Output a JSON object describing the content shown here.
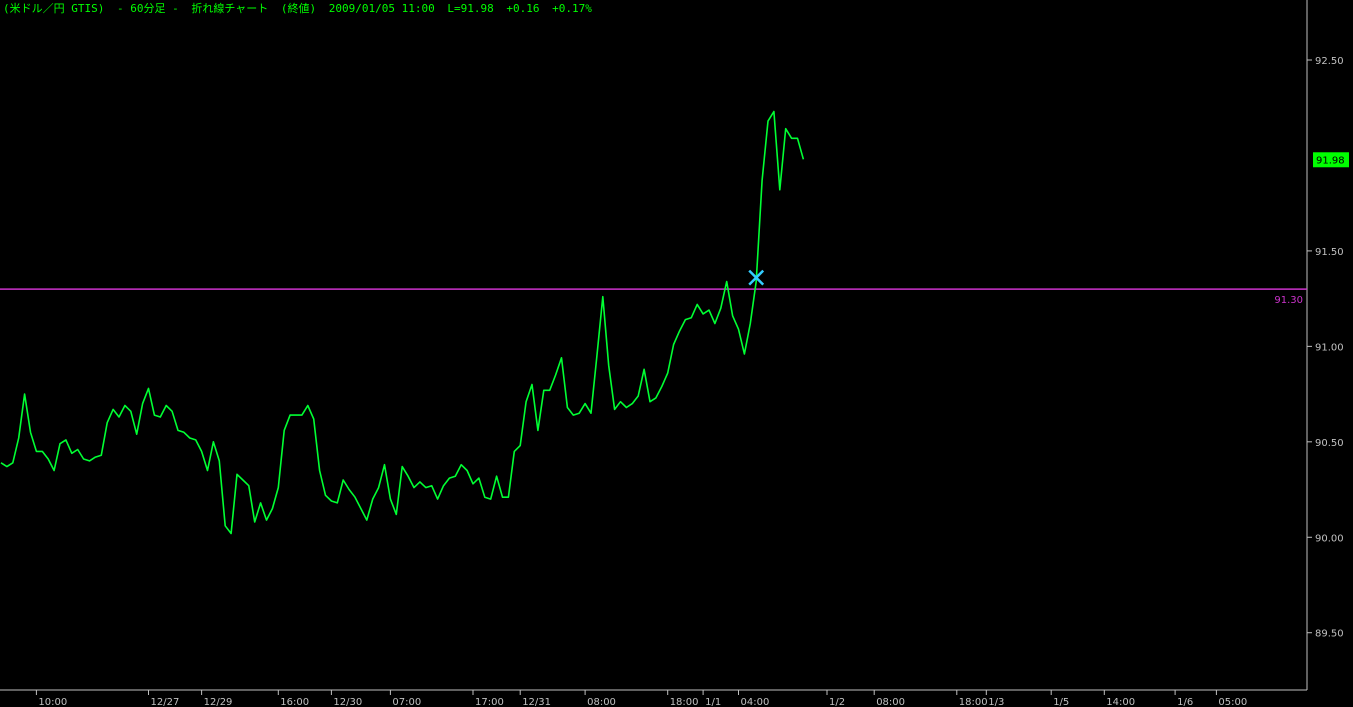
{
  "header": {
    "instrument": "(米ドル／円 GTIS)",
    "timeframe": "- 60分足 -",
    "chart_kind": "折れ線チャート",
    "price_type": "(終値)",
    "datetime": "2009/01/05 11:00",
    "last": "L=91.98",
    "change": "+0.16",
    "change_pct": "+0.17%"
  },
  "colors": {
    "background": "#000000",
    "line": "#00ff33",
    "axis": "#c0c0c0",
    "tick_text": "#c0c0c0",
    "hline": "#cc33cc",
    "marker": "#33ccff",
    "last_badge_bg": "#00ff00",
    "last_badge_text": "#000000"
  },
  "chart_data": {
    "type": "line",
    "title": "",
    "xlabel": "",
    "ylabel": "",
    "ylim": [
      89.2,
      92.72
    ],
    "y_ticks": [
      "92.50",
      "91.50",
      "91.00",
      "90.50",
      "90.00",
      "89.50"
    ],
    "x_ticks": [
      "10:00",
      "12/27",
      "12/29",
      "16:00",
      "12/30",
      "07:00",
      "17:00",
      "12/31",
      "08:00",
      "18:00",
      "1/1",
      "04:00",
      "1/2",
      "08:00",
      "18:00",
      "1/3",
      "1/5",
      "14:00",
      "1/6",
      "05:00"
    ],
    "x_tick_index": [
      6,
      25,
      34,
      47,
      56,
      66,
      80,
      88,
      99,
      113,
      119,
      125,
      140,
      148,
      162,
      167,
      178,
      187,
      199,
      206
    ],
    "x_count": 222,
    "series": [
      {
        "values": [
          90.39,
          90.37,
          90.39,
          90.52,
          90.75,
          90.55,
          90.45,
          90.45,
          90.41,
          90.35,
          90.49,
          90.51,
          90.44,
          90.46,
          90.41,
          90.4,
          90.42,
          90.43,
          90.6,
          90.67,
          90.63,
          90.69,
          90.66,
          90.54,
          90.7,
          90.78,
          90.64,
          90.63,
          90.69,
          90.66,
          90.56,
          90.55,
          90.52,
          90.51,
          90.45,
          90.35,
          90.5,
          90.4,
          90.06,
          90.02,
          90.33,
          90.3,
          90.27,
          90.08,
          90.18,
          90.09,
          90.15,
          90.26,
          90.56,
          90.64,
          90.64,
          90.64,
          90.69,
          90.62,
          90.35,
          90.22,
          90.19,
          90.18,
          90.3,
          90.25,
          90.21,
          90.15,
          90.09,
          90.2,
          90.26,
          90.38,
          90.2,
          90.12,
          90.37,
          90.32,
          90.26,
          90.29,
          90.26,
          90.27,
          90.2,
          90.27,
          90.31,
          90.32,
          90.38,
          90.35,
          90.28,
          90.31,
          90.21,
          90.2,
          90.32,
          90.21,
          90.21,
          90.45,
          90.48,
          90.71,
          90.8,
          90.56,
          90.77,
          90.77,
          90.85,
          90.94,
          90.68,
          90.64,
          90.65,
          90.7,
          90.65,
          90.95,
          91.26,
          90.9,
          90.67,
          90.71,
          90.68,
          90.7,
          90.74,
          90.88,
          90.71,
          90.73,
          90.79,
          90.86,
          91.01,
          91.08,
          91.14,
          91.15,
          91.22,
          91.17,
          91.19,
          91.12,
          91.2,
          91.34,
          91.16,
          91.09,
          90.96,
          91.12,
          91.34,
          91.87,
          92.18,
          92.23,
          91.82,
          92.14,
          92.09,
          92.09,
          91.98
        ]
      }
    ],
    "series_x_start": 0,
    "series_x_step": 1,
    "hline": {
      "value": 91.3,
      "label": "91.30"
    },
    "marker": {
      "x_index": 128,
      "value": 91.36
    },
    "last_value_label": "91.98",
    "last_value": 91.98,
    "grid": false,
    "legend": "none"
  }
}
